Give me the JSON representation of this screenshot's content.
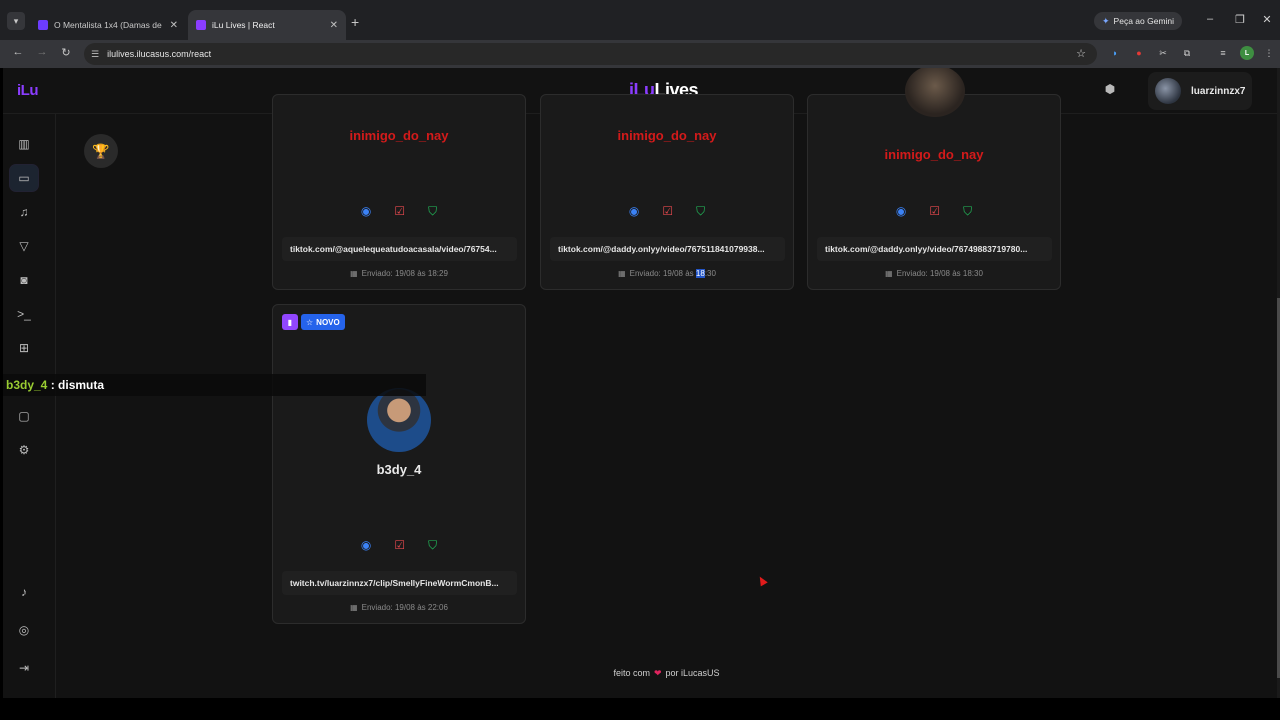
{
  "browser": {
    "tabs": [
      {
        "title": "O Mentalista 1x4 (Damas de Ve...",
        "active": false
      },
      {
        "title": "iLu Lives | React",
        "active": true
      }
    ],
    "new_tab_icon": "plus-icon",
    "gemini_label": "Peça ao Gemini",
    "url": "ilulives.ilucasus.com/react",
    "profile_initial": "L"
  },
  "header": {
    "logo_small": "iLu",
    "brand_part1": "iLu",
    "brand_part2": "Lives",
    "username": "luarzinnzx7"
  },
  "sidebar": {
    "items": [
      {
        "icon": "bar-chart-icon",
        "active": false
      },
      {
        "icon": "monitor-icon",
        "active": true
      },
      {
        "icon": "music-icon",
        "active": false
      },
      {
        "icon": "filter-icon",
        "active": false
      },
      {
        "icon": "camera-icon",
        "active": false
      },
      {
        "icon": "terminal-icon",
        "active": false
      },
      {
        "icon": "gift-icon",
        "active": false
      },
      {
        "icon": "message-icon",
        "active": false
      },
      {
        "icon": "settings-icon",
        "active": false
      }
    ],
    "bottom": [
      {
        "icon": "bell-icon"
      },
      {
        "icon": "help-icon"
      },
      {
        "icon": "logout-icon"
      }
    ]
  },
  "cards": [
    {
      "name": "inimigo_do_nay",
      "link": "tiktok.com/@aquelequeatudoacasala/video/76754...",
      "date": "Enviado: 19/08 às 18:29"
    },
    {
      "name": "inimigo_do_nay",
      "link": "tiktok.com/@daddy.onlyy/video/767511841079938...",
      "date_prefix": "Enviado: 19/08 às ",
      "date_highlight": "18",
      "date_suffix": ":30"
    },
    {
      "name": "inimigo_do_nay",
      "link": "tiktok.com/@daddy.onlyy/video/76749883719780...",
      "date": "Enviado: 19/08 às 18:30"
    },
    {
      "name": "b3dy_4",
      "badge": "NOVO",
      "link": "twitch.tv/luarzinnzx7/clip/SmellyFineWormCmonB...",
      "date": "Enviado: 19/08 às 22:06"
    }
  ],
  "overlay": {
    "user": "b3dy_4",
    "separator": " : ",
    "message": "dismuta"
  },
  "footer": {
    "prefix": "feito com",
    "suffix": "por iLucasUS"
  },
  "colors": {
    "brand": "#8b3dff",
    "danger_name": "#d41a1a",
    "view": "#3b82f6",
    "check": "#e5484d",
    "shield": "#22c55e",
    "novo": "#2563eb",
    "twitch": "#9146ff"
  }
}
